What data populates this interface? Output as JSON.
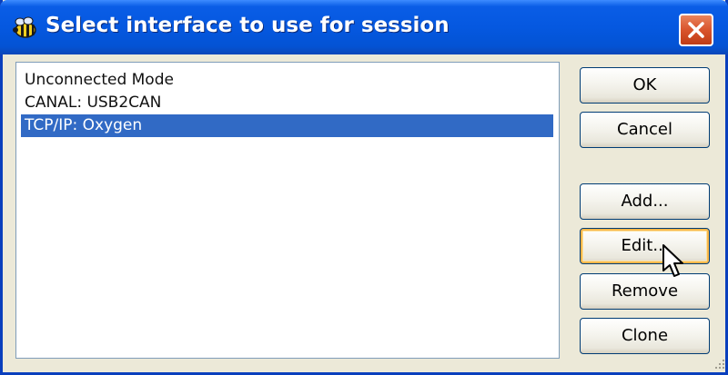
{
  "window": {
    "title": "Select interface to use for session",
    "close_icon": "close-icon",
    "app_icon": "bee-icon"
  },
  "interface_list": {
    "items": [
      {
        "label": "Unconnected Mode",
        "selected": false
      },
      {
        "label": "CANAL: USB2CAN",
        "selected": false
      },
      {
        "label": "TCP/IP: Oxygen",
        "selected": true
      }
    ]
  },
  "buttons": {
    "ok": "OK",
    "cancel": "Cancel",
    "add": "Add...",
    "edit": "Edit...",
    "remove": "Remove",
    "clone": "Clone"
  },
  "colors": {
    "titlebar": "#0558e0",
    "selection": "#316ac5",
    "close_button": "#d9542c",
    "dialog_background": "#ece9d8"
  }
}
